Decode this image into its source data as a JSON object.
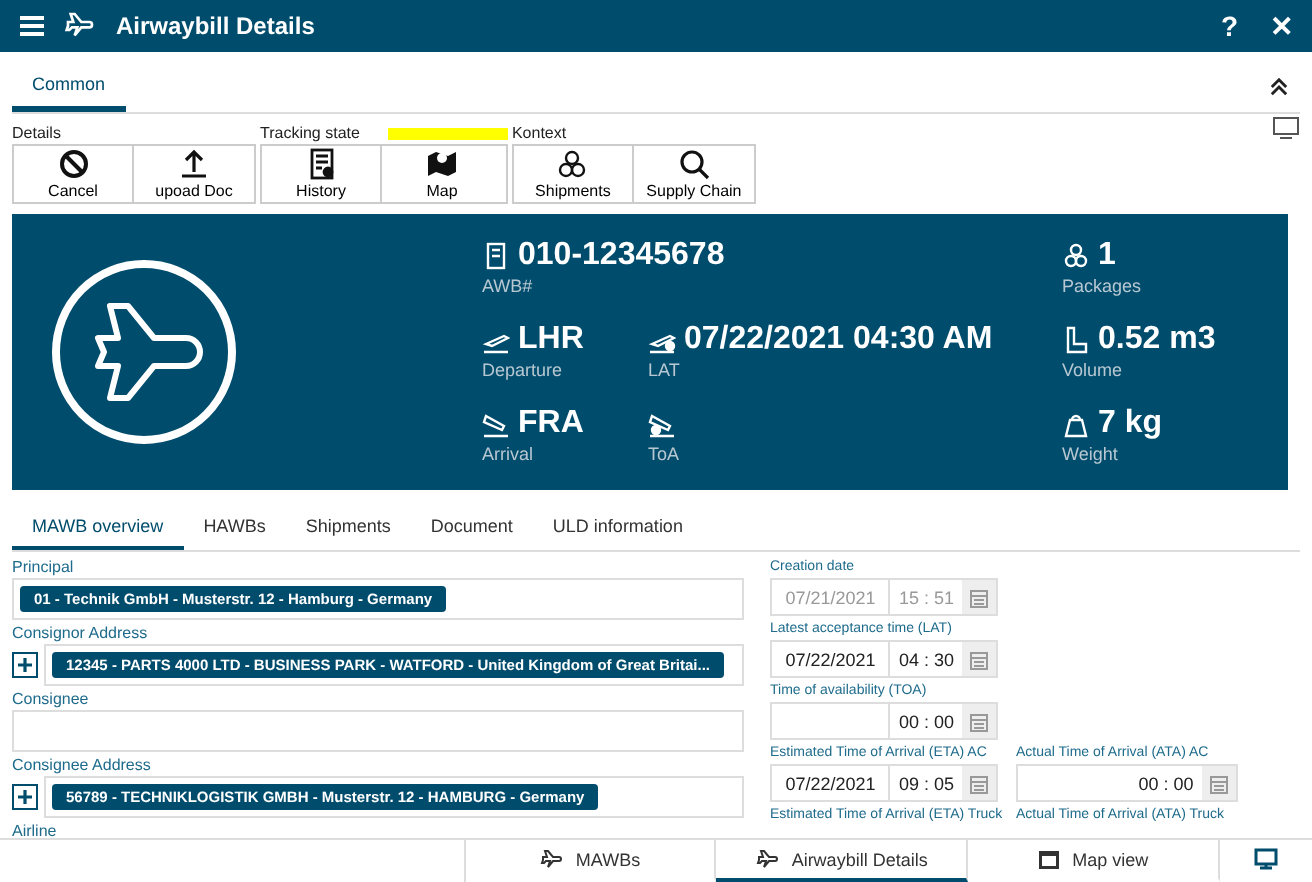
{
  "window": {
    "title": "Airwaybill Details",
    "help": "?",
    "close": "✕"
  },
  "top_tabs": [
    {
      "label": "Common",
      "selected": true
    }
  ],
  "toolbar_groups": [
    {
      "label": "Details",
      "buttons": [
        {
          "label": "Cancel"
        },
        {
          "label": "upoad Doc"
        }
      ]
    },
    {
      "label": "Tracking state",
      "color": "#ffff00",
      "buttons": [
        {
          "label": "History"
        },
        {
          "label": "Map"
        }
      ]
    },
    {
      "label": "Kontext",
      "buttons": [
        {
          "label": "Shipments"
        },
        {
          "label": "Supply Chain"
        }
      ]
    }
  ],
  "summary": {
    "awb": {
      "value": "010-12345678",
      "label": "AWB#"
    },
    "packages": {
      "value": "1",
      "label": "Packages"
    },
    "departure": {
      "value": "LHR",
      "label": "Departure"
    },
    "lat": {
      "value": "07/22/2021 04:30 AM",
      "label": "LAT"
    },
    "volume": {
      "value": "0.52 m3",
      "label": "Volume"
    },
    "arrival": {
      "value": "FRA",
      "label": "Arrival"
    },
    "toa": {
      "label": "ToA"
    },
    "weight": {
      "value": "7 kg",
      "label": "Weight"
    }
  },
  "tabs": [
    {
      "label": "MAWB overview",
      "selected": true
    },
    {
      "label": "HAWBs",
      "selected": false
    },
    {
      "label": "Shipments",
      "selected": false
    },
    {
      "label": "Document",
      "selected": false
    },
    {
      "label": "ULD information",
      "selected": false
    }
  ],
  "left_fields": [
    {
      "label": "Principal",
      "chip": "01 - Technik GmbH - Musterstr. 12 - Hamburg - Germany",
      "add_button": false
    },
    {
      "label": "Consignor Address",
      "chip": "12345 - PARTS 4000 LTD - BUSINESS PARK - WATFORD - United Kingdom of Great Britai...",
      "add_button": true
    },
    {
      "label": "Consignee",
      "add_button": false
    },
    {
      "label": "Consignee Address",
      "chip": "56789 - TECHNIKLOGISTIK GMBH - Musterstr. 12 - HAMBURG - Germany",
      "add_button": true
    },
    {
      "label": "Airline"
    }
  ],
  "right_rows": [
    [
      {
        "label": "Creation date",
        "date": "07/21/2021",
        "time": "15 : 51",
        "disabled": true
      }
    ],
    [
      {
        "label": "Latest acceptance time (LAT)",
        "date": "07/22/2021",
        "time": "04 : 30",
        "disabled": false
      }
    ],
    [
      {
        "label": "Time of availability (TOA)",
        "time": "00 : 00",
        "disabled": false
      }
    ],
    [
      {
        "label": "Estimated Time of Arrival (ETA) AC",
        "date": "07/22/2021",
        "time": "09 : 05",
        "disabled": false
      },
      {
        "label": "Actual Time of Arrival (ATA) AC",
        "time": "00 : 00",
        "disabled": false
      }
    ],
    [
      {
        "label": "Estimated Time of Arrival (ETA) Truck"
      },
      {
        "label": "Actual Time of Arrival (ATA) Truck"
      }
    ]
  ],
  "bottom_tabs": [
    {
      "label": "MAWBs",
      "selected": false
    },
    {
      "label": "Airwaybill Details",
      "selected": true
    },
    {
      "label": "Map view",
      "selected": false
    },
    {
      "selected": false
    }
  ]
}
